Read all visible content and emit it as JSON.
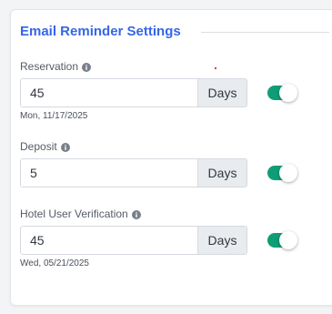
{
  "section": {
    "title": "Email Reminder Settings"
  },
  "fields": [
    {
      "label": "Reservation",
      "value": "45",
      "unit": "Days",
      "enabled": true,
      "date": "Mon, 11/17/2025"
    },
    {
      "label": "Deposit",
      "value": "5",
      "unit": "Days",
      "enabled": true,
      "date": ""
    },
    {
      "label": "Hotel User Verification",
      "value": "45",
      "unit": "Days",
      "enabled": true,
      "date": "Wed, 05/21/2025"
    }
  ],
  "colors": {
    "title": "#3566e6",
    "toggle_on": "#0f9d76",
    "addon_bg": "#e9ecef"
  },
  "icons": {
    "info": "info-circle-icon"
  }
}
